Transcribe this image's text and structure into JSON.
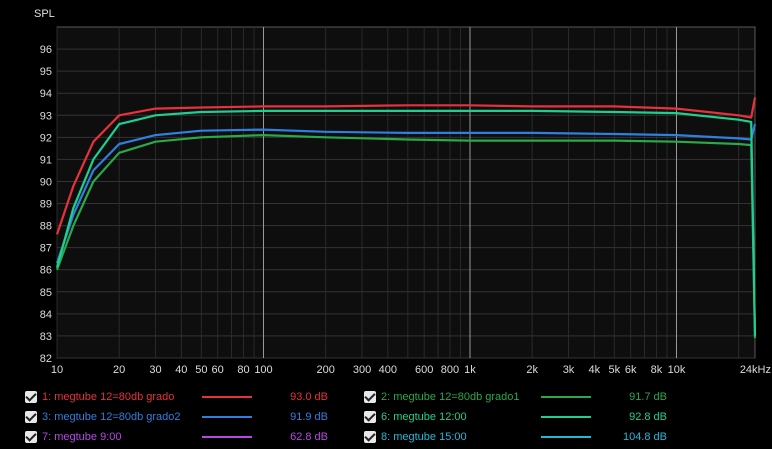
{
  "chart_data": {
    "type": "line",
    "ylabel": "SPL",
    "xlabel": "",
    "xscale": "log",
    "xlim": [
      10,
      24000
    ],
    "ylim": [
      82,
      97
    ],
    "yticks": [
      "82",
      "83",
      "84",
      "85",
      "86",
      "87",
      "88",
      "89",
      "90",
      "91",
      "92",
      "93",
      "94",
      "95",
      "96"
    ],
    "xticks": [
      {
        "v": 10,
        "label": "10"
      },
      {
        "v": 20,
        "label": "20"
      },
      {
        "v": 30,
        "label": "30"
      },
      {
        "v": 40,
        "label": "40"
      },
      {
        "v": 50,
        "label": "50"
      },
      {
        "v": 60,
        "label": "60"
      },
      {
        "v": 80,
        "label": "80"
      },
      {
        "v": 100,
        "label": "100"
      },
      {
        "v": 200,
        "label": "200"
      },
      {
        "v": 300,
        "label": "300"
      },
      {
        "v": 400,
        "label": "400"
      },
      {
        "v": 600,
        "label": "600"
      },
      {
        "v": 800,
        "label": "800"
      },
      {
        "v": 1000,
        "label": "1k"
      },
      {
        "v": 2000,
        "label": "2k"
      },
      {
        "v": 3000,
        "label": "3k"
      },
      {
        "v": 4000,
        "label": "4k"
      },
      {
        "v": 5000,
        "label": "5k"
      },
      {
        "v": 6000,
        "label": "6k"
      },
      {
        "v": 8000,
        "label": "8k"
      },
      {
        "v": 10000,
        "label": "10k"
      },
      {
        "v": 24000,
        "label": "24kHz"
      }
    ],
    "grid": true,
    "series": [
      {
        "name": "1: megtube 12=80db grado",
        "value": "93.0 dB",
        "color": "#e8313a",
        "x": [
          10,
          12,
          15,
          20,
          30,
          50,
          100,
          200,
          500,
          1000,
          2000,
          5000,
          10000,
          20000,
          23000,
          24000
        ],
        "y": [
          87.6,
          89.8,
          91.8,
          93.0,
          93.3,
          93.35,
          93.4,
          93.4,
          93.45,
          93.45,
          93.4,
          93.4,
          93.3,
          93.0,
          92.9,
          93.8
        ]
      },
      {
        "name": "2: megtube 12=80db grado1",
        "value": "91.7 dB",
        "color": "#2aa84a",
        "x": [
          10,
          12,
          15,
          20,
          30,
          50,
          100,
          200,
          500,
          1000,
          2000,
          5000,
          10000,
          20000,
          23000,
          24000
        ],
        "y": [
          86.0,
          88.0,
          90.0,
          91.3,
          91.8,
          92.0,
          92.1,
          92.0,
          91.9,
          91.85,
          91.85,
          91.85,
          91.8,
          91.7,
          91.65,
          82.9
        ]
      },
      {
        "name": "3: megtube 12=80db grado2",
        "value": "91.9 dB",
        "color": "#2f7fe0",
        "x": [
          10,
          12,
          15,
          20,
          30,
          50,
          100,
          200,
          500,
          1000,
          2000,
          5000,
          10000,
          20000,
          23000,
          24000
        ],
        "y": [
          86.3,
          88.5,
          90.5,
          91.7,
          92.1,
          92.3,
          92.35,
          92.25,
          92.2,
          92.2,
          92.2,
          92.15,
          92.1,
          91.95,
          91.9,
          92.6
        ]
      },
      {
        "name": "6: megtube 12:00",
        "value": "92.8 dB",
        "color": "#1fcf8f",
        "x": [
          10,
          12,
          15,
          20,
          30,
          50,
          100,
          200,
          500,
          1000,
          2000,
          5000,
          10000,
          20000,
          23000,
          24000
        ],
        "y": [
          86.1,
          88.8,
          91.0,
          92.6,
          93.0,
          93.15,
          93.2,
          93.2,
          93.2,
          93.2,
          93.2,
          93.15,
          93.1,
          92.8,
          92.7,
          83.0
        ]
      },
      {
        "name": "7: megtube 9:00",
        "value": "62.8 dB",
        "color": "#b548e6",
        "x": [],
        "y": []
      },
      {
        "name": "8: megtube 15:00",
        "value": "104.8 dB",
        "color": "#22b8d8",
        "x": [],
        "y": []
      }
    ]
  }
}
